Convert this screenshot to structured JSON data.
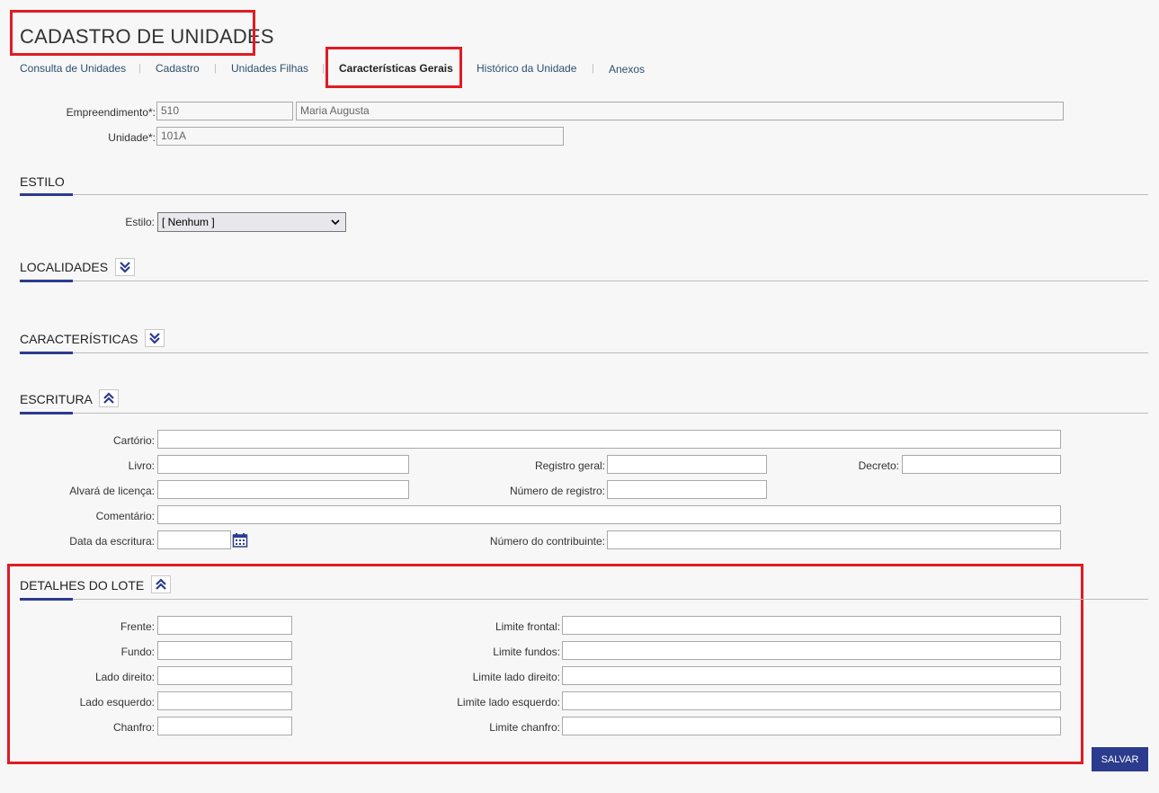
{
  "page": {
    "title": "CADASTRO DE UNIDADES"
  },
  "tabs": [
    {
      "label": "Consulta de Unidades"
    },
    {
      "label": "Cadastro"
    },
    {
      "label": "Unidades Filhas"
    },
    {
      "label": "Características Gerais",
      "active": true
    },
    {
      "label": "Histórico da Unidade"
    },
    {
      "label": "Anexos"
    }
  ],
  "header_form": {
    "empreendimento_label": "Empreendimento*:",
    "empreendimento_code": "510",
    "empreendimento_name": "Maria Augusta",
    "unidade_label": "Unidade*:",
    "unidade_value": "101A"
  },
  "estilo": {
    "section_title": "ESTILO",
    "label": "Estilo:",
    "selected": "[ Nenhum ]"
  },
  "localidades": {
    "section_title": "LOCALIDADES",
    "state": "collapsed"
  },
  "caracteristicas": {
    "section_title": "CARACTERÍSTICAS",
    "state": "collapsed"
  },
  "escritura": {
    "section_title": "ESCRITURA",
    "state": "expanded",
    "cartorio_label": "Cartório:",
    "livro_label": "Livro:",
    "registro_geral_label": "Registro geral:",
    "decreto_label": "Decreto:",
    "alvara_label": "Alvará de licença:",
    "numero_registro_label": "Número de registro:",
    "comentario_label": "Comentário:",
    "data_escritura_label": "Data da escritura:",
    "numero_contribuinte_label": "Número do contribuinte:"
  },
  "detalhes_lote": {
    "section_title": "DETALHES DO LOTE",
    "state": "expanded",
    "frente_label": "Frente:",
    "fundo_label": "Fundo:",
    "lado_direito_label": "Lado direito:",
    "lado_esquerdo_label": "Lado esquerdo:",
    "chanfro_label": "Chanfro:",
    "limite_frontal_label": "Limite frontal:",
    "limite_fundos_label": "Limite fundos:",
    "limite_lado_direito_label": "Limite lado direito:",
    "limite_lado_esquerdo_label": "Limite lado esquerdo:",
    "limite_chanfro_label": "Limite chanfro:"
  },
  "actions": {
    "save_label": "SALVAR"
  },
  "colors": {
    "accent": "#2b3b8e",
    "highlight": "#e01b24"
  }
}
